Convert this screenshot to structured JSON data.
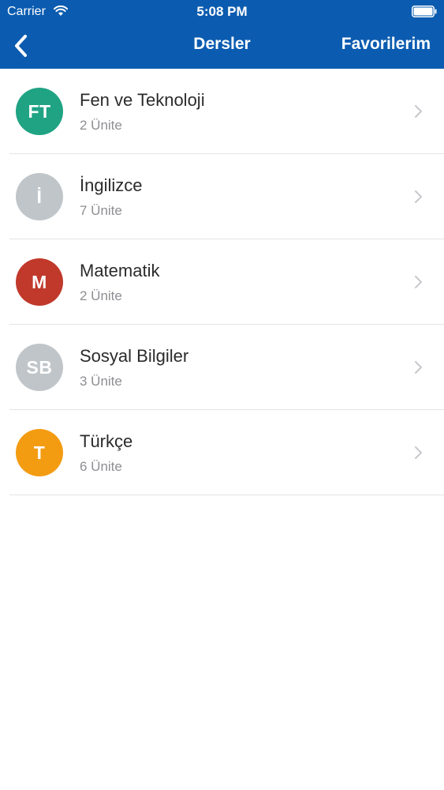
{
  "status_bar": {
    "carrier": "Carrier",
    "time": "5:08 PM"
  },
  "nav": {
    "title": "Dersler",
    "right_label": "Favorilerim",
    "back_icon": "chevron-left-icon"
  },
  "colors": {
    "header": "#0b5cb0",
    "separator": "#e4e4e6",
    "subtitle": "#8e8e93",
    "chevron": "#c7c7cc"
  },
  "lessons": [
    {
      "initials": "FT",
      "title": "Fen ve Teknoloji",
      "subtitle": "2 Ünite",
      "color": "#1fa383"
    },
    {
      "initials": "İ",
      "title": "İngilizce",
      "subtitle": "7 Ünite",
      "color": "#bfc5c9"
    },
    {
      "initials": "M",
      "title": "Matematik",
      "subtitle": "2 Ünite",
      "color": "#c0392b"
    },
    {
      "initials": "SB",
      "title": "Sosyal Bilgiler",
      "subtitle": "3 Ünite",
      "color": "#bfc5c9"
    },
    {
      "initials": "T",
      "title": "Türkçe",
      "subtitle": "6 Ünite",
      "color": "#f39c12"
    }
  ]
}
